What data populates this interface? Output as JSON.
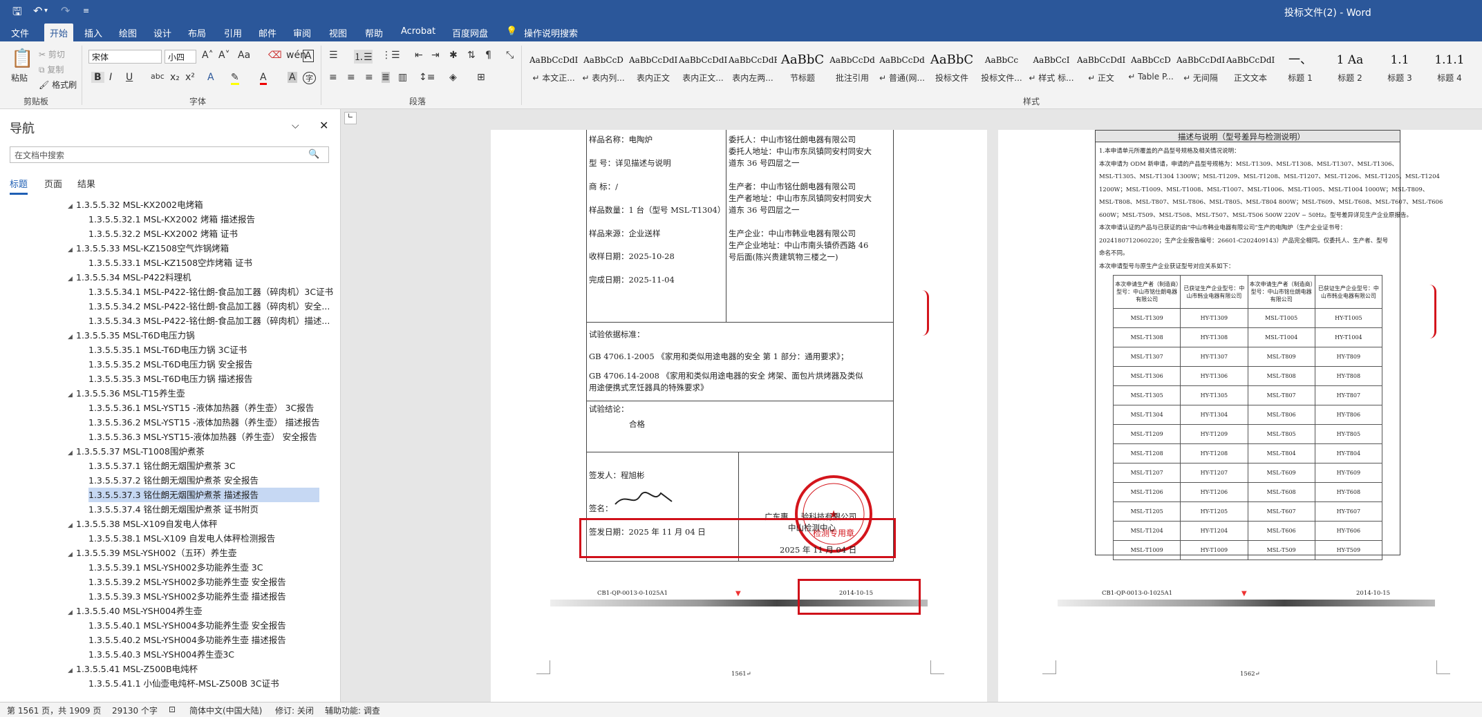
{
  "titlebar": {
    "doc_title": "投标文件(2)  -  Word"
  },
  "tabs": [
    "文件",
    "开始",
    "插入",
    "绘图",
    "设计",
    "布局",
    "引用",
    "邮件",
    "审阅",
    "视图",
    "帮助",
    "Acrobat",
    "百度网盘"
  ],
  "tell_me": "操作说明搜索",
  "ribbon": {
    "clipboard": {
      "paste": "粘贴",
      "cut": "剪切",
      "copy": "复制",
      "format_painter": "格式刷",
      "label": "剪贴板"
    },
    "font": {
      "name": "宋体",
      "size": "小四",
      "label": "字体"
    },
    "paragraph": {
      "label": "段落"
    },
    "styles": {
      "label": "样式",
      "items": [
        {
          "preview": "AaBbCcDdI",
          "name": "↵ 本文正..."
        },
        {
          "preview": "AaBbCcD",
          "name": "↵ 表内列..."
        },
        {
          "preview": "AaBbCcDdI",
          "name": "表内正文"
        },
        {
          "preview": "AaBbCcDdI",
          "name": "表内正文..."
        },
        {
          "preview": "AaBbCcDdEe",
          "name": "表内左两..."
        },
        {
          "preview": "AaBbC",
          "name": "节标题"
        },
        {
          "preview": "AaBbCcDd",
          "name": "批注引用"
        },
        {
          "preview": "AaBbCcDd",
          "name": "↵ 普通(网..."
        },
        {
          "preview": "AaBbC",
          "name": "投标文件"
        },
        {
          "preview": "AaBbCc",
          "name": "投标文件..."
        },
        {
          "preview": "AaBbCcI",
          "name": "↵ 样式 标..."
        },
        {
          "preview": "AaBbCcDdI",
          "name": "↵ 正文"
        },
        {
          "preview": "AaBbCcD",
          "name": "↵ Table P..."
        },
        {
          "preview": "AaBbCcDdI",
          "name": "↵ 无间隔"
        },
        {
          "preview": "AaBbCcDdI",
          "name": "正文文本"
        },
        {
          "preview": "一、",
          "name": "标题 1"
        },
        {
          "preview": "1  Aa",
          "name": "标题 2"
        },
        {
          "preview": "1.1",
          "name": "标题 3"
        },
        {
          "preview": "1.1.1",
          "name": "标题 4"
        }
      ]
    }
  },
  "nav": {
    "title": "导航",
    "search_placeholder": "在文档中搜索",
    "tabs": [
      "标题",
      "页面",
      "结果"
    ],
    "items": [
      {
        "level": 1,
        "text": "1.3.5.5.32 MSL-KX2002电烤箱"
      },
      {
        "level": 2,
        "text": "1.3.5.5.32.1 MSL-KX2002 烤箱 描述报告"
      },
      {
        "level": 2,
        "text": "1.3.5.5.32.2 MSL-KX2002 烤箱 证书"
      },
      {
        "level": 1,
        "text": "1.3.5.5.33 MSL-KZ1508空气炸锅烤箱"
      },
      {
        "level": 2,
        "text": "1.3.5.5.33.1 MSL-KZ1508空炸烤箱 证书"
      },
      {
        "level": 1,
        "text": "1.3.5.5.34 MSL-P422料理机"
      },
      {
        "level": 2,
        "text": "1.3.5.5.34.1 MSL-P422-铭仕朗-食品加工器（碎肉机）3C证书"
      },
      {
        "level": 2,
        "text": "1.3.5.5.34.2 MSL-P422-铭仕朗-食品加工器（碎肉机）安全..."
      },
      {
        "level": 2,
        "text": "1.3.5.5.34.3 MSL-P422-铭仕朗-食品加工器（碎肉机）描述..."
      },
      {
        "level": 1,
        "text": "1.3.5.5.35 MSL-T6D电压力锅"
      },
      {
        "level": 2,
        "text": "1.3.5.5.35.1 MSL-T6D电压力锅 3C证书"
      },
      {
        "level": 2,
        "text": "1.3.5.5.35.2 MSL-T6D电压力锅 安全报告"
      },
      {
        "level": 2,
        "text": "1.3.5.5.35.3 MSL-T6D电压力锅 描述报告"
      },
      {
        "level": 1,
        "text": "1.3.5.5.36 MSL-T15养生壶"
      },
      {
        "level": 2,
        "text": "1.3.5.5.36.1 MSL-YST15 -液体加热器（养生壶） 3C报告"
      },
      {
        "level": 2,
        "text": "1.3.5.5.36.2 MSL-YST15 -液体加热器（养生壶） 描述报告"
      },
      {
        "level": 2,
        "text": "1.3.5.5.36.3 MSL-YST15-液体加热器（养生壶） 安全报告"
      },
      {
        "level": 1,
        "text": "1.3.5.5.37 MSL-T1008围炉煮茶"
      },
      {
        "level": 2,
        "text": "1.3.5.5.37.1 铭仕朗无烟围炉煮茶  3C"
      },
      {
        "level": 2,
        "text": "1.3.5.5.37.2 铭仕朗无烟围炉煮茶  安全报告"
      },
      {
        "level": 2,
        "text": "1.3.5.5.37.3 铭仕朗无烟围炉煮茶  描述报告",
        "selected": true
      },
      {
        "level": 2,
        "text": "1.3.5.5.37.4 铭仕朗无烟围炉煮茶  证书附页"
      },
      {
        "level": 1,
        "text": "1.3.5.5.38 MSL-X109自发电人体秤"
      },
      {
        "level": 2,
        "text": "1.3.5.5.38.1 MSL-X109 自发电人体秤检测报告"
      },
      {
        "level": 1,
        "text": "1.3.5.5.39 MSL-YSH002（五环）养生壶"
      },
      {
        "level": 2,
        "text": "1.3.5.5.39.1 MSL-YSH002多功能养生壶 3C"
      },
      {
        "level": 2,
        "text": "1.3.5.5.39.2 MSL-YSH002多功能养生壶 安全报告"
      },
      {
        "level": 2,
        "text": "1.3.5.5.39.3 MSL-YSH002多功能养生壶 描述报告"
      },
      {
        "level": 1,
        "text": "1.3.5.5.40 MSL-YSH004养生壶"
      },
      {
        "level": 2,
        "text": "1.3.5.5.40.1 MSL-YSH004多功能养生壶 安全报告"
      },
      {
        "level": 2,
        "text": "1.3.5.5.40.2 MSL-YSH004多功能养生壶 描述报告"
      },
      {
        "level": 2,
        "text": "1.3.5.5.40.3 MSL-YSH004养生壶3C"
      },
      {
        "level": 1,
        "text": "1.3.5.5.41 MSL-Z500B电炖杯"
      },
      {
        "level": 2,
        "text": "1.3.5.5.41.1 小仙壶电炖杯-MSL-Z500B  3C证书"
      }
    ]
  },
  "page1": {
    "left_fields": [
      "样品名称：电陶炉",
      "型    号：详见描述与说明",
      "商    标：/",
      "样品数量：1 台（型号 MSL-T1304）",
      "样品来源：企业送样",
      "收样日期：2025-10-28",
      "完成日期：2025-11-04"
    ],
    "right_fields": [
      "委托人：中山市铭仕朗电器有限公司",
      "委托人地址：中山市东凤镇同安村同安大",
      "道东 36 号四层之一",
      "生产者：中山市铭仕朗电器有限公司",
      "生产者地址：中山市东凤镇同安村同安大",
      "道东 36 号四层之一",
      "生产企业：中山市韩业电器有限公司",
      "生产企业地址：中山市南头镇侨西路 46",
      "号后面(陈兴贵建筑物三楼之一)"
    ],
    "basis_title": "试验依据标准：",
    "basis": [
      "GB 4706.1-2005 《家用和类似用途电器的安全 第 1 部分：通用要求》；",
      "GB 4706.14-2008 《家用和类似用途电器的安全 烤架、面包片烘烤器及类似",
      "用途便携式烹饪器具的特殊要求》"
    ],
    "conclusion_title": "试验结论：",
    "conclusion": "合格",
    "issuer": "签发人：程旭彬",
    "sign": "签名：",
    "sign_date": "签发日期：2025 年 11 月 04 日",
    "org": "广东惠 ... 验科技有限公司",
    "org2": "中山检测中心",
    "stamp_date": "2025 年 11 月 04 日",
    "stamp_text": "检测专用章",
    "footer_code": "CB1-QP-0013-0-1025A1",
    "footer_date": "2014-10-15",
    "page_num": "1561↵"
  },
  "page2": {
    "heading": "描述与说明（型号差异与检测说明）",
    "lines": [
      "1.本申请单元所覆盖的产品型号规格及相关情况说明：",
      "    本次申请为 ODM 新申请，申请的产品型号规格为：MSL-T1309、MSL-T1308、MSL-T1307、MSL-T1306、",
      "MSL-T1305、MSL-T1304 1300W；MSL-T1209、MSL-T1208、MSL-T1207、MSL-T1206、MSL-T1205、MSL-T1204",
      "1200W；MSL-T1009、MSL-T1008、MSL-T1007、MSL-T1006、MSL-T1005、MSL-T1004 1000W；MSL-T809、",
      "MSL-T808、MSL-T807、MSL-T806、MSL-T805、MSL-T804  800W；MSL-T609、MSL-T608、MSL-T607、MSL-T606",
      "600W；MSL-T509、MSL-T508、MSL-T507、MSL-T506  500W 220V ~ 50Hz。型号差异详见生产企业原报告。",
      "    本次申请认证的产品与已获证的由“中山市韩业电器有限公司”生产的电陶炉（生产企业证书号：",
      "2024180712060220；生产企业报告编号：26601-C202409143）产品完全相同。仅委托人、生产者、型号",
      "命名不同。",
      "    本次申请型号与原生产企业获证型号对应关系如下："
    ],
    "table_headers": [
      "本次申请生产者（制造商）型号：中山市铭仕朗电器有限公司",
      "已获证生产企业型号：中山市韩业电器有限公司",
      "本次申请生产者（制造商）型号：中山市铭仕朗电器有限公司",
      "已获证生产企业型号：中山市韩业电器有限公司"
    ],
    "table_rows": [
      [
        "MSL-T1309",
        "HY-T1309",
        "MSL-T1005",
        "HY-T1005"
      ],
      [
        "MSL-T1308",
        "HY-T1308",
        "MSL-T1004",
        "HY-T1004"
      ],
      [
        "MSL-T1307",
        "HY-T1307",
        "MSL-T809",
        "HY-T809"
      ],
      [
        "MSL-T1306",
        "HY-T1306",
        "MSL-T808",
        "HY-T808"
      ],
      [
        "MSL-T1305",
        "HY-T1305",
        "MSL-T807",
        "HY-T807"
      ],
      [
        "MSL-T1304",
        "HY-T1304",
        "MSL-T806",
        "HY-T806"
      ],
      [
        "MSL-T1209",
        "HY-T1209",
        "MSL-T805",
        "HY-T805"
      ],
      [
        "MSL-T1208",
        "HY-T1208",
        "MSL-T804",
        "HY-T804"
      ],
      [
        "MSL-T1207",
        "HY-T1207",
        "MSL-T609",
        "HY-T609"
      ],
      [
        "MSL-T1206",
        "HY-T1206",
        "MSL-T608",
        "HY-T608"
      ],
      [
        "MSL-T1205",
        "HY-T1205",
        "MSL-T607",
        "HY-T607"
      ],
      [
        "MSL-T1204",
        "HY-T1204",
        "MSL-T606",
        "HY-T606"
      ],
      [
        "MSL-T1009",
        "HY-T1009",
        "MSL-T509",
        "HY-T509"
      ]
    ],
    "footer_code": "CB1-QP-0013-0-1025A1",
    "footer_date": "2014-10-15",
    "page_num": "1562↵"
  },
  "statusbar": {
    "page": "第 1561 页，共 1909 页",
    "words": "29130 个字",
    "lang": "简体中文(中国大陆)",
    "track": "修订: 关闭",
    "access": "辅助功能: 调查"
  }
}
